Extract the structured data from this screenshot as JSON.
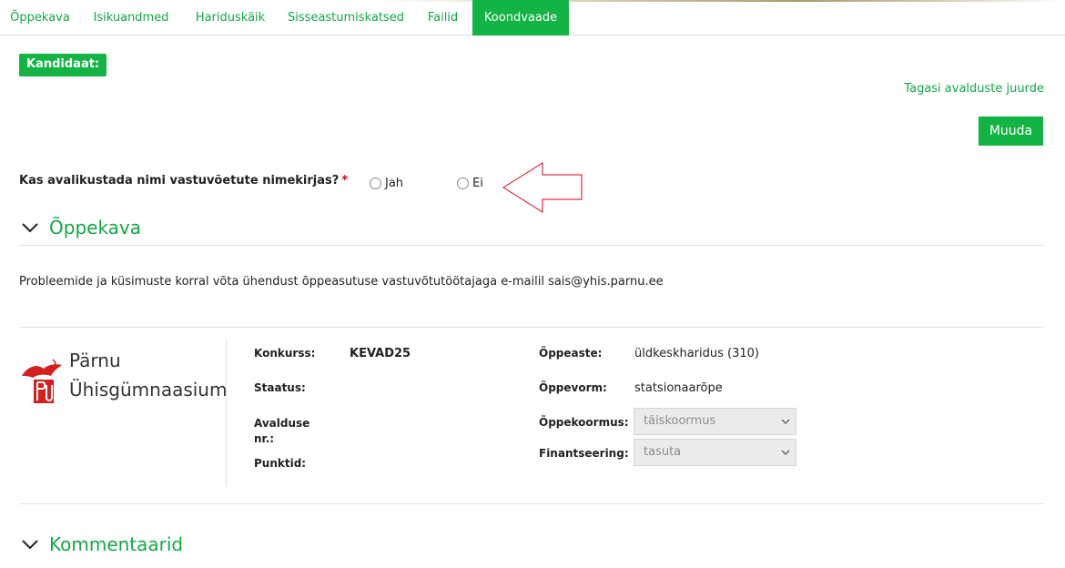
{
  "tabs": [
    {
      "label": "Õppekava"
    },
    {
      "label": "Isikuandmed"
    },
    {
      "label": "Hariduskäik"
    },
    {
      "label": "Sisseastumiskatsed"
    },
    {
      "label": "Failid"
    },
    {
      "label": "Koondvaade",
      "active": true
    }
  ],
  "candidate_badge": "Kandidaat:",
  "back_link": "Tagasi avalduste juurde",
  "edit_button": "Muuda",
  "publish_question": {
    "label": "Kas avalikustada nimi vastuvõetute nimekirjas?",
    "required_mark": "*",
    "options": [
      "Jah",
      "Ei"
    ],
    "selected": null
  },
  "sections": {
    "curriculum_title": "Õppekava",
    "comments_title": "Kommentaarid"
  },
  "contact_text": "Probleemide ja küsimuste korral võta ühendust õppeasutuse vastuvõtutöötajaga e-mailil sais@yhis.parnu.ee",
  "school": {
    "name_line1": "Pärnu",
    "name_line2": "Ühisgümnaasium"
  },
  "application": {
    "konkurss_label": "Konkurss:",
    "konkurss_value": "KEVAD25",
    "staatus_label": "Staatus:",
    "avaldus_label_line1": "Avalduse",
    "avaldus_label_line2": "nr.:",
    "punktid_label": "Punktid:",
    "oppeaste_label": "Õppeaste:",
    "oppeaste_value": "üldkeskharidus (310)",
    "oppevorm_label": "Õppevorm:",
    "oppevorm_value": "statsionaarõpe",
    "oppekoormus_label": "Õppekoormus:",
    "oppekoormus_value": "täiskoormus",
    "finantseering_label": "Finantseering:",
    "finantseering_value": "tasuta"
  },
  "colors": {
    "accent": "#13b445",
    "link": "#12a845",
    "required": "#d0021b",
    "annotation_arrow": "#d0021b"
  }
}
